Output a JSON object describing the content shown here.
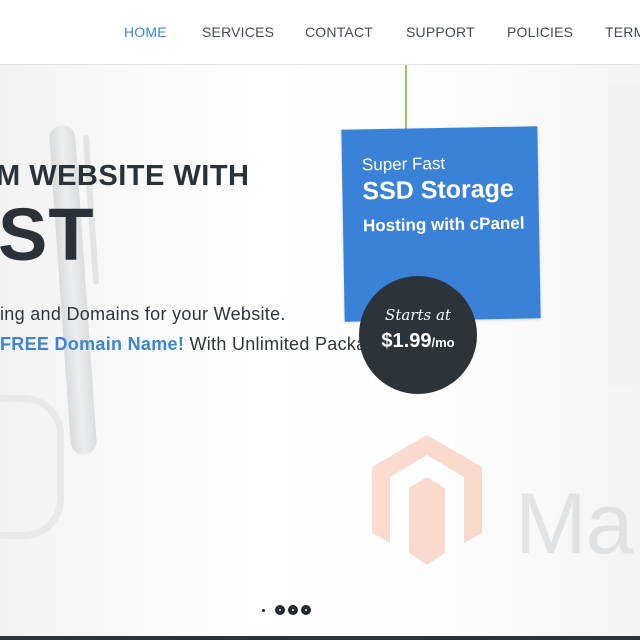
{
  "nav": {
    "items": [
      {
        "label": "HOME",
        "active": true
      },
      {
        "label": "SERVICES",
        "active": false
      },
      {
        "label": "CONTACT",
        "active": false
      },
      {
        "label": "SUPPORT",
        "active": false
      },
      {
        "label": "POLICIES",
        "active": false
      },
      {
        "label": "TERM",
        "active": false
      }
    ]
  },
  "hero": {
    "headline_line1": "M WEBSITE WITH",
    "headline_line2": "ST",
    "subline1": "ing and Domains for your Website.",
    "subline2_highlight": "FREE Domain Name!",
    "subline2_rest": " With Unlimited Package",
    "background_text": "Ma"
  },
  "promo": {
    "line1": "Super Fast",
    "line2": "SSD Storage",
    "line3": "Hosting with cPanel",
    "badge_top": "Starts at",
    "badge_amount": "$1.99",
    "badge_period": "/mo"
  },
  "slider": {
    "dots": 4,
    "active_index": 0
  },
  "colors": {
    "accent": "#3a86d4",
    "promo_card": "#3a82d8",
    "badge": "#2c3339",
    "text_dark": "#2b3138",
    "string": "#8fcf5a"
  }
}
